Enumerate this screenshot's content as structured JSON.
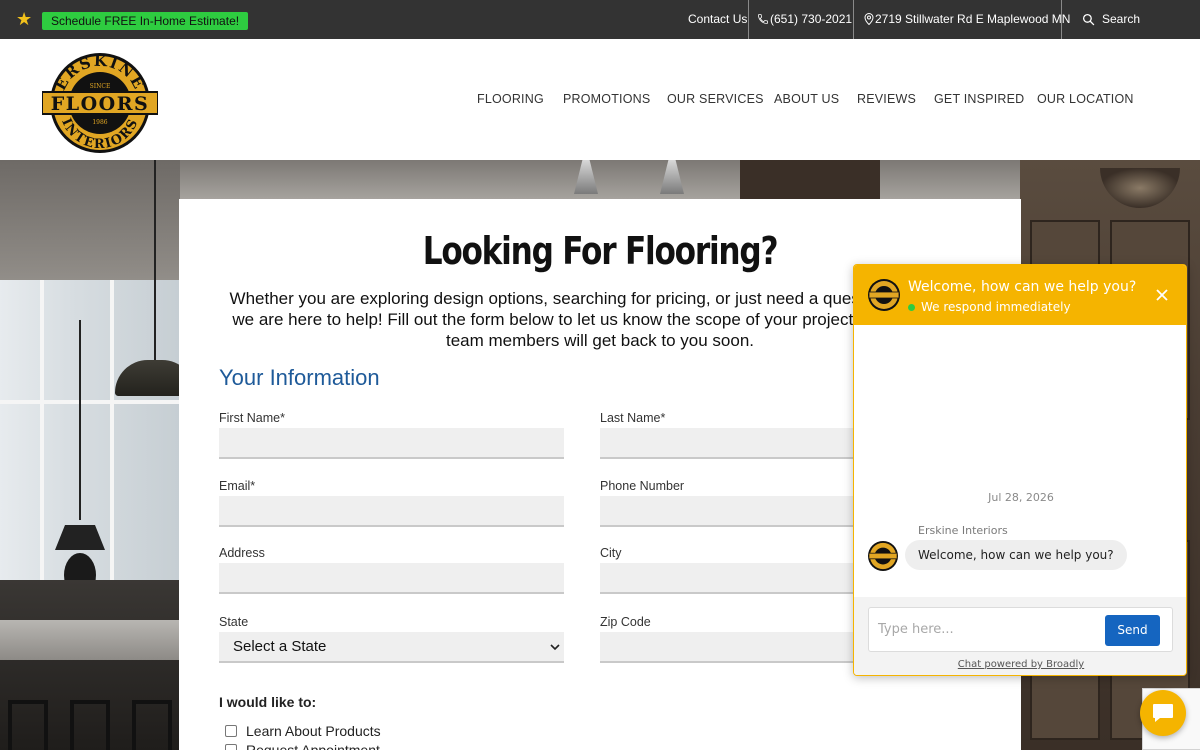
{
  "topbar": {
    "estimate_label": "Schedule FREE In-Home Estimate!",
    "contact_label": "Contact Us",
    "phone": "(651) 730-2021",
    "address": "2719 Stillwater Rd E Maplewood MN",
    "search_label": "Search"
  },
  "logo": {
    "top_text": "ERSKINE",
    "since": "SINCE",
    "main_text": "FLOORS",
    "year": "1986",
    "bottom_text": "INTERIORS"
  },
  "nav": {
    "items": [
      "FLOORING",
      "PROMOTIONS",
      "OUR SERVICES",
      "ABOUT US",
      "REVIEWS",
      "GET INSPIRED",
      "OUR LOCATION"
    ]
  },
  "form": {
    "heading": "Looking For Flooring?",
    "intro": "Whether you are exploring design options, searching for pricing, or just need a question answered, we are here to help! Fill out the form below to let us know the scope of your project and one of our team members will get back to you soon.",
    "section_title": "Your Information",
    "fields": {
      "first_name": "First Name*",
      "last_name": "Last Name*",
      "email": "Email*",
      "phone": "Phone Number",
      "address": "Address",
      "city": "City",
      "state": "State",
      "zip": "Zip Code"
    },
    "state_selected": "Select a State",
    "wish_title": "I would like to:",
    "options": [
      "Learn About Products",
      "Request Appointment"
    ]
  },
  "chat": {
    "title": "Welcome, how can we help you?",
    "status": "We respond immediately",
    "date": "Jul 28, 2026",
    "sender": "Erskine Interiors",
    "message": "Welcome, how can we help you?",
    "input_placeholder": "Type here...",
    "send_label": "Send",
    "powered_by": "Chat powered by Broadly"
  },
  "colors": {
    "topbar_bg": "#333333",
    "estimate_bg": "#2ecc40",
    "section_title": "#1e5a99",
    "chat_accent": "#f5b400",
    "send_button": "#1565c0"
  }
}
